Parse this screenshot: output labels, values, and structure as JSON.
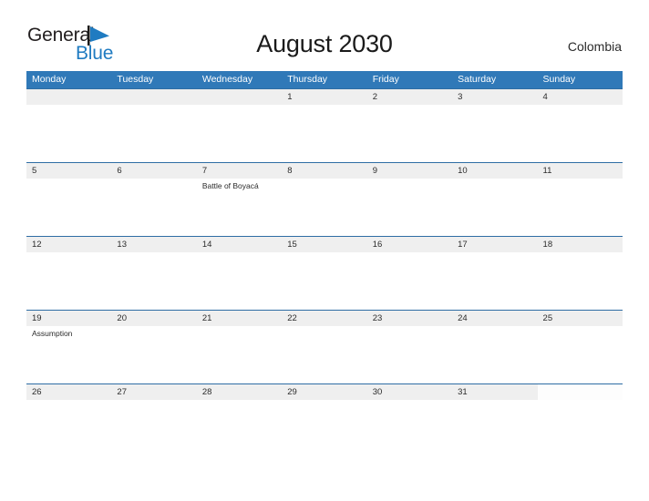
{
  "brand": {
    "name_part1": "General",
    "name_part2": "Blue",
    "flag_icon": "blue-triangle-flag-icon"
  },
  "header": {
    "title": "August 2030",
    "country": "Colombia"
  },
  "colors": {
    "header_blue": "#3079b8",
    "row_rule_blue": "#2e6da4",
    "band_gray": "#efefef",
    "brand_blue": "#1f7bc1",
    "text_dark": "#2b2b2b"
  },
  "calendar": {
    "weekdays": [
      "Monday",
      "Tuesday",
      "Wednesday",
      "Thursday",
      "Friday",
      "Saturday",
      "Sunday"
    ],
    "weeks": [
      [
        {
          "day": "",
          "event": ""
        },
        {
          "day": "",
          "event": ""
        },
        {
          "day": "",
          "event": ""
        },
        {
          "day": "1",
          "event": ""
        },
        {
          "day": "2",
          "event": ""
        },
        {
          "day": "3",
          "event": ""
        },
        {
          "day": "4",
          "event": ""
        }
      ],
      [
        {
          "day": "5",
          "event": ""
        },
        {
          "day": "6",
          "event": ""
        },
        {
          "day": "7",
          "event": "Battle of Boyacá"
        },
        {
          "day": "8",
          "event": ""
        },
        {
          "day": "9",
          "event": ""
        },
        {
          "day": "10",
          "event": ""
        },
        {
          "day": "11",
          "event": ""
        }
      ],
      [
        {
          "day": "12",
          "event": ""
        },
        {
          "day": "13",
          "event": ""
        },
        {
          "day": "14",
          "event": ""
        },
        {
          "day": "15",
          "event": ""
        },
        {
          "day": "16",
          "event": ""
        },
        {
          "day": "17",
          "event": ""
        },
        {
          "day": "18",
          "event": ""
        }
      ],
      [
        {
          "day": "19",
          "event": "Assumption"
        },
        {
          "day": "20",
          "event": ""
        },
        {
          "day": "21",
          "event": ""
        },
        {
          "day": "22",
          "event": ""
        },
        {
          "day": "23",
          "event": ""
        },
        {
          "day": "24",
          "event": ""
        },
        {
          "day": "25",
          "event": ""
        }
      ],
      [
        {
          "day": "26",
          "event": ""
        },
        {
          "day": "27",
          "event": ""
        },
        {
          "day": "28",
          "event": ""
        },
        {
          "day": "29",
          "event": ""
        },
        {
          "day": "30",
          "event": ""
        },
        {
          "day": "31",
          "event": ""
        },
        {
          "day": "",
          "event": ""
        }
      ]
    ]
  }
}
